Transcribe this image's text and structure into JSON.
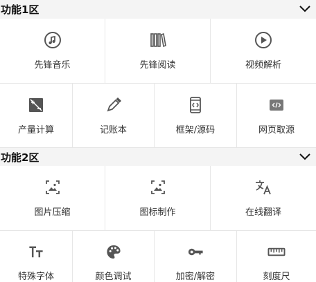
{
  "sections": [
    {
      "title": "功能1区",
      "rows": [
        [
          "先锋音乐",
          "先锋阅读",
          "视频解析"
        ],
        [
          "产量计算",
          "记账本",
          "框架/源码",
          "网页取源"
        ]
      ]
    },
    {
      "title": "功能2区",
      "rows": [
        [
          "图片压缩",
          "图标制作",
          "在线翻译"
        ],
        [
          "特殊字体",
          "颜色调试",
          "加密/解密",
          "刻度尺"
        ]
      ]
    }
  ]
}
